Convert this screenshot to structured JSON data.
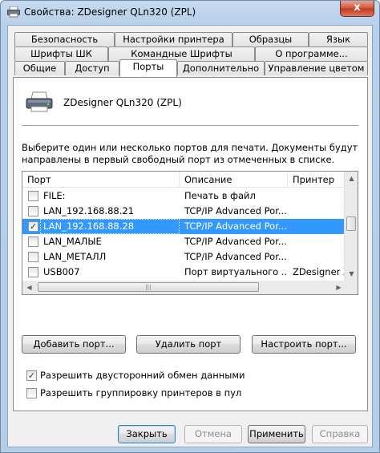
{
  "window": {
    "title": "Свойства: ZDesigner QLn320 (ZPL)",
    "close_glyph": "x"
  },
  "tabs_row1": [
    "Безопасность",
    "Настройки принтера",
    "Образцы",
    "Язык"
  ],
  "tabs_row2": [
    "Шрифты ШК",
    "Командные Шрифты",
    "О программе..."
  ],
  "tabs_row3": [
    "Общие",
    "Доступ",
    "Порты",
    "Дополнительно",
    "Управление цветом"
  ],
  "active_tab": "Порты",
  "printer_name": "ZDesigner QLn320 (ZPL)",
  "description": "Выберите один или несколько портов для печати. Документы будут направлены в первый свободный порт из отмеченных в списке.",
  "columns": {
    "port": "Порт",
    "description": "Описание",
    "printer": "Принтер"
  },
  "ports": [
    {
      "port": "FILE:",
      "description": "Печать в файл",
      "printer": "",
      "checked": false,
      "selected": false
    },
    {
      "port": "LAN_192.168.88.21",
      "description": "TCP/IP Advanced Por...",
      "printer": "",
      "checked": false,
      "selected": false
    },
    {
      "port": "LAN_192.168.88.28",
      "description": "TCP/IP Advanced Por...",
      "printer": "",
      "checked": true,
      "selected": true
    },
    {
      "port": "LAN_МАЛЫЕ",
      "description": "TCP/IP Advanced Por...",
      "printer": "",
      "checked": false,
      "selected": false
    },
    {
      "port": "LAN_МЕТАЛЛ",
      "description": "TCP/IP Advanced Por...",
      "printer": "",
      "checked": false,
      "selected": false
    },
    {
      "port": "USB007",
      "description": "Порт виртуального ...",
      "printer": "ZDesigner Z",
      "checked": false,
      "selected": false
    }
  ],
  "buttons": {
    "add_port": "Добавить порт...",
    "delete_port": "Удалить порт",
    "configure_port": "Настроить порт..."
  },
  "options": {
    "bidirectional": {
      "label": "Разрешить двусторонний обмен данными",
      "checked": true
    },
    "pooling": {
      "label": "Разрешить группировку принтеров в пул",
      "checked": false
    }
  },
  "footer": {
    "close": "Закрыть",
    "cancel": "Отмена",
    "apply": "Применить",
    "help": "Справка"
  },
  "check_glyph": "✓"
}
